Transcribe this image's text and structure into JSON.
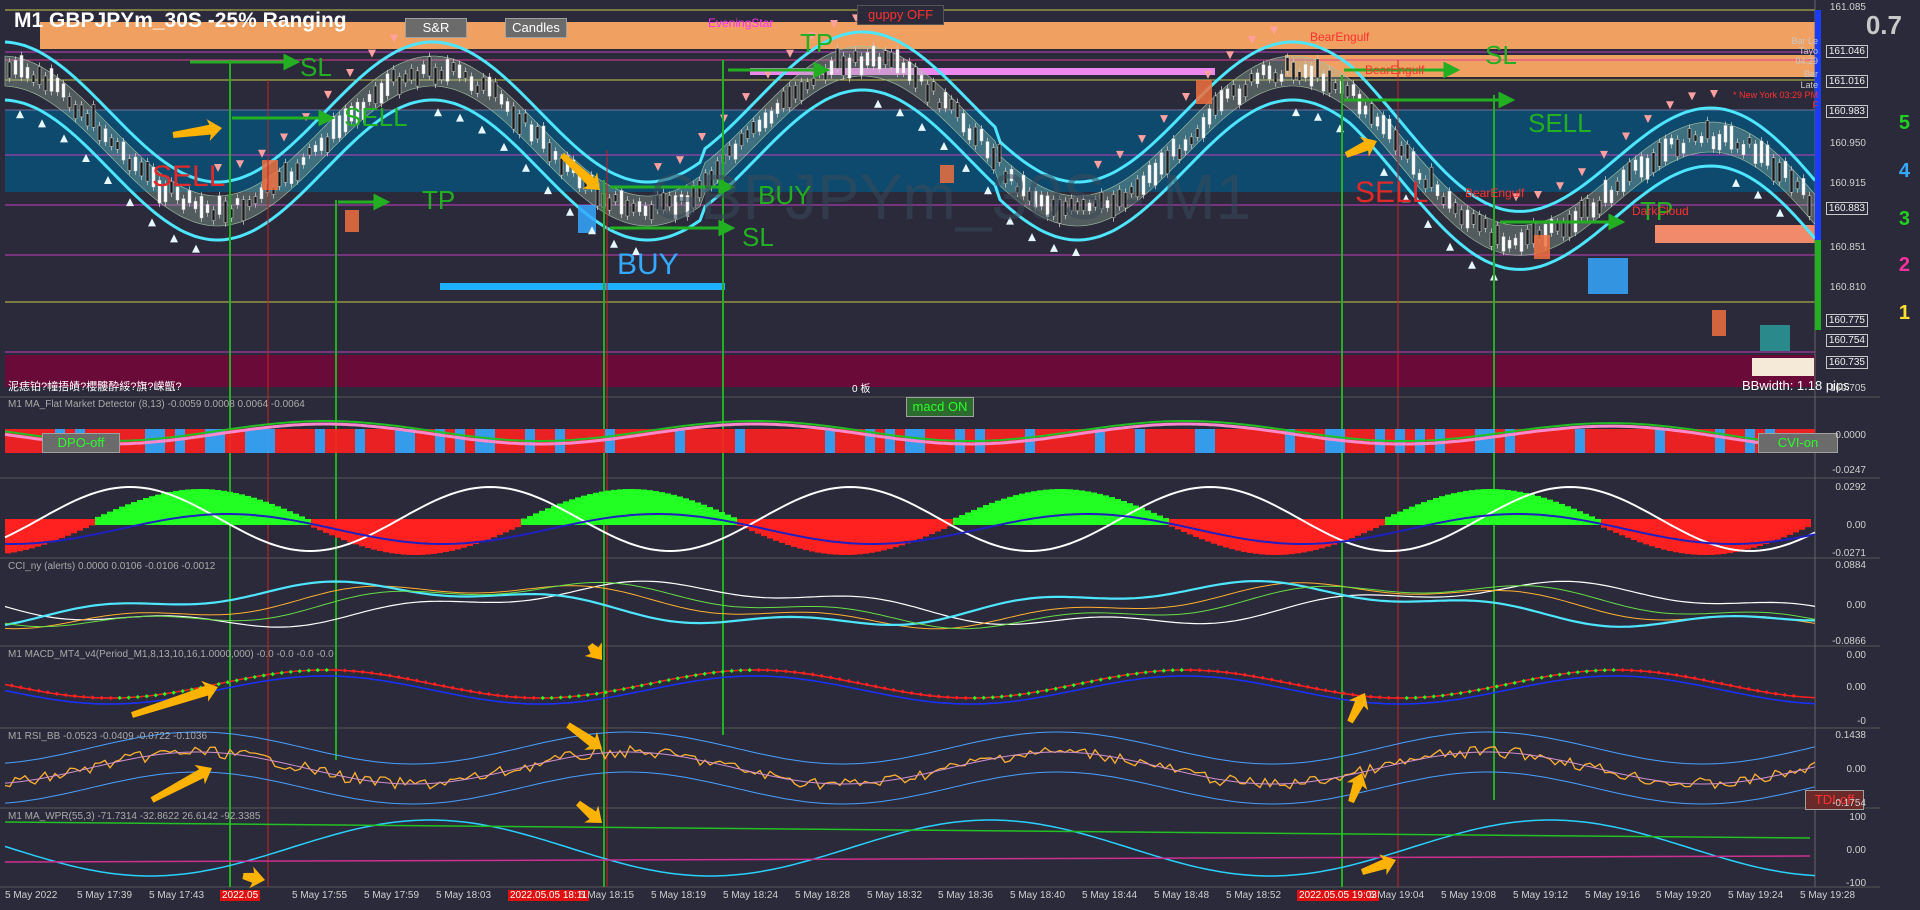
{
  "title": "M1  GBPJPYm_30S  -25% Ranging",
  "watermark": "GBPJPYm_30S - M1",
  "buttons": {
    "sr": "S&R",
    "candles": "Candles",
    "guppy": "guppy OFF",
    "macd": "macd ON",
    "dpo": "DPO-off",
    "cvi": "CVI-on",
    "tdi": "TDI-off"
  },
  "main_labels": {
    "sell1": "SELL",
    "sell2": "SELL",
    "sell3": "SELL",
    "sell4": "SELL",
    "buy1": "BUY",
    "buy2": "BUY",
    "sl1": "SL",
    "sl2": "SL",
    "sl3": "SL",
    "tp1": "TP",
    "tp2": "TP",
    "tp3": "TP",
    "evening_star": "EveningStar",
    "bear_engulf1": "BearEngulf",
    "bear_engulf2": "BearEngulf",
    "dark_cloud": "DarkCloud",
    "bear_engulf3": "BearEngulf",
    "bbwidth": "BBwidth: 1.18 pips",
    "garbled_text": "泥痣铂?幢捂皟?櫻髏酔綏?旗?嵘甑?",
    "zero_label": "0 板"
  },
  "price_axis": [
    "161.085",
    "161.046",
    "161.016",
    "160.983",
    "160.950",
    "160.915",
    "160.883",
    "160.851",
    "160.810",
    "160.775",
    "160.754",
    "160.735",
    "160.705"
  ],
  "side_numbers": [
    "0.7",
    "5",
    "4",
    "3",
    "2",
    "1"
  ],
  "right_notes": [
    "Bar Le",
    "Tayo",
    "04:29",
    "Bar",
    "Late",
    "* New York 03:29 PM",
    "F"
  ],
  "indicators": [
    {
      "name": "M1 MA_Flat Market Detector (8,13) -0.0059 0.0008 0.0064 -0.0064",
      "axis": [
        "0.0000",
        "-0.0247"
      ]
    },
    {
      "name": "",
      "axis": [
        "0.0292",
        "0.00",
        "-0.0271"
      ]
    },
    {
      "name": "CCI_ny (alerts) 0.0000 0.0106 -0.0106 -0.0012",
      "axis": [
        "0.0884",
        "0.00",
        "-0.0866"
      ]
    },
    {
      "name": "M1 MACD_MT4_v4(Period_M1,8,13,10,16,1.0000,000) -0.0 -0.0 -0.0 -0.0",
      "axis": [
        "0.00",
        "0.00",
        "-0"
      ]
    },
    {
      "name": "M1 RSI_BB -0.0523 -0.0409 -0.0722 -0.1036",
      "axis": [
        "0.1438",
        "0.00",
        "-0.1754"
      ]
    },
    {
      "name": "M1 MA_WPR(55,3) -71.7314 -32.8622 26.6142 -92.3385",
      "axis": [
        "100",
        "0.00",
        "-100"
      ]
    }
  ],
  "time_axis": [
    "5 May 2022",
    "5 May 17:39",
    "5 May 17:43",
    "2022.05",
    "5 May 17:55",
    "5 May 17:59",
    "5 May 18:03",
    "2022.05.05 18:11",
    "5 May 18:15",
    "5 May 18:19",
    "5 May 18:24",
    "5 May 18:28",
    "5 May 18:32",
    "5 May 18:36",
    "5 May 18:40",
    "5 May 18:44",
    "5 May 18:48",
    "5 May 18:52",
    "2022.05.05 19:03",
    "5 May 19:04",
    "5 May 19:08",
    "5 May 19:12",
    "5 May 19:16",
    "5 May 19:20",
    "5 May 19:24",
    "5 May 19:28"
  ],
  "colors": {
    "background": "#2a2a3a",
    "ma_band": "#4ee6ff",
    "signal_green": "#22b022",
    "sell_red": "#e02a2a",
    "buy_blue": "#35a8ff",
    "arrow_yellow": "#ffb300",
    "zone_orange": "#f0a060",
    "zone_teal": "#0d4a6e",
    "zone_maroon": "#7a0a3e"
  }
}
